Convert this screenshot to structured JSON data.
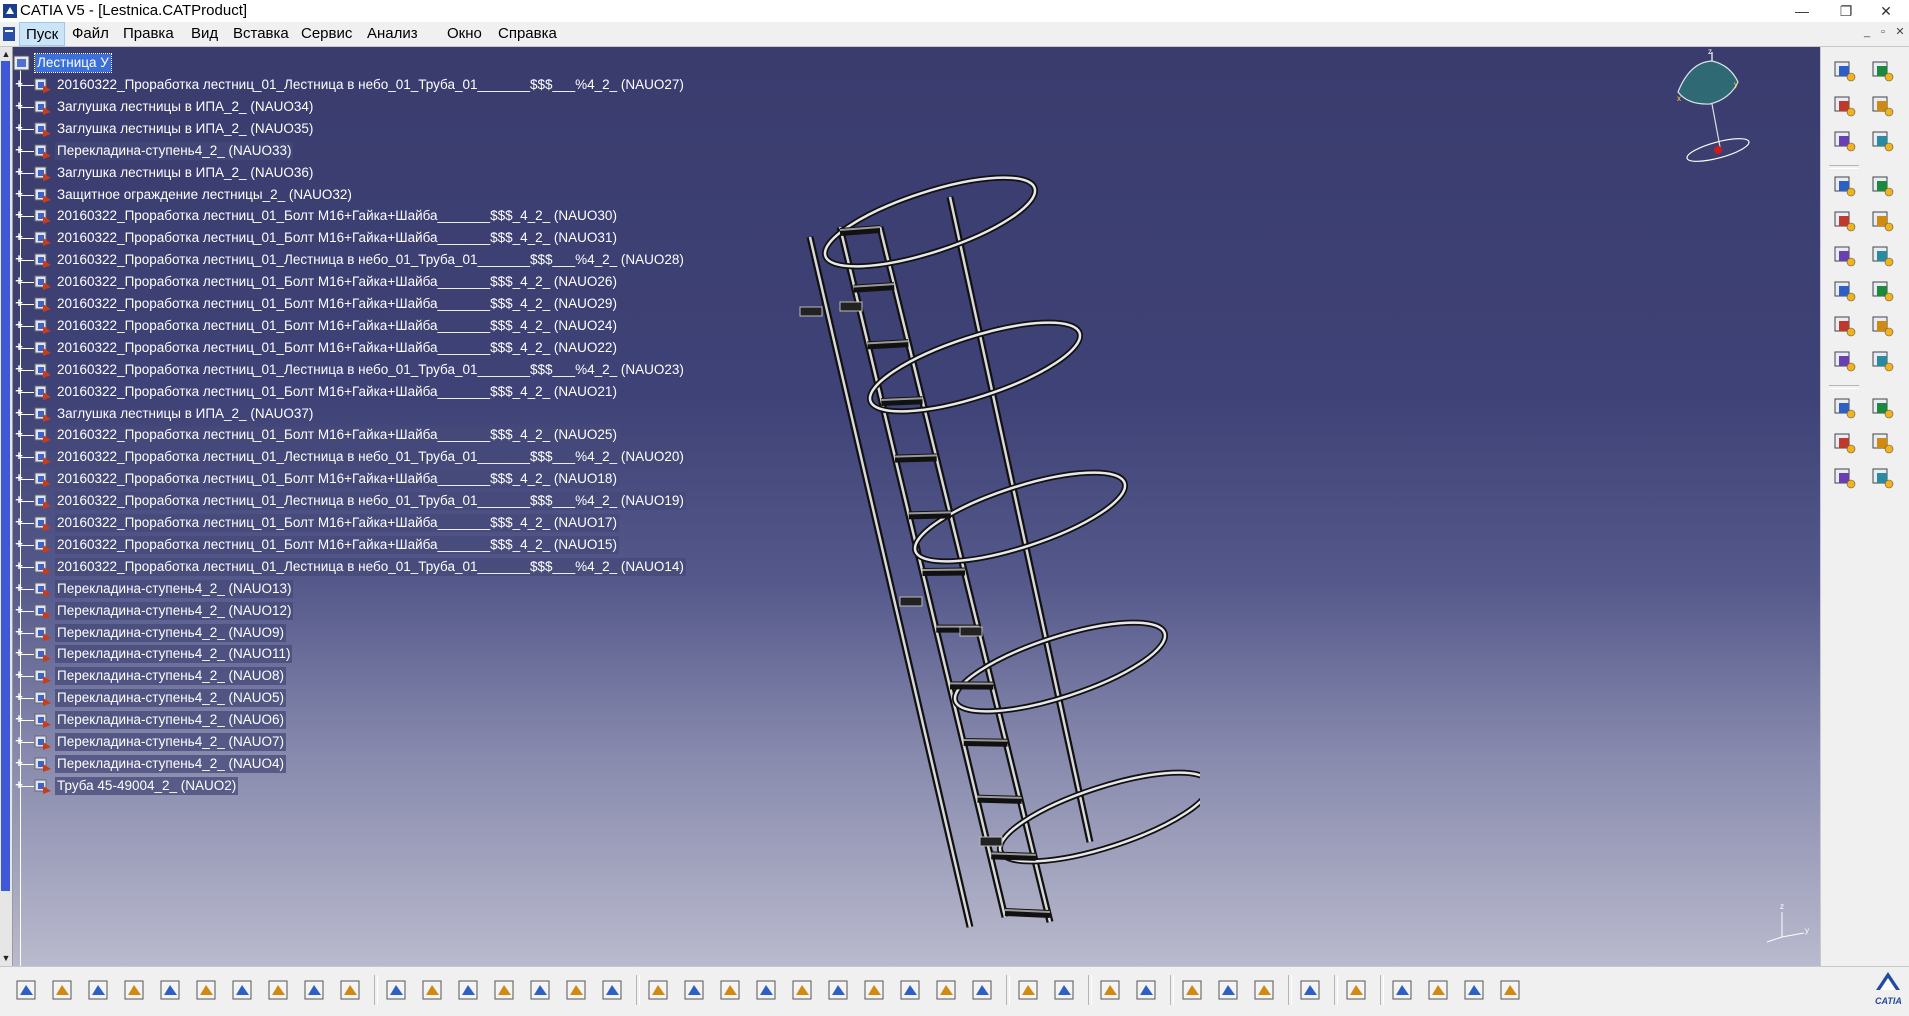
{
  "window": {
    "title": "CATIA V5 - [Lestnica.CATProduct]",
    "minimize": "—",
    "restore": "❐",
    "close": "✕"
  },
  "menu": {
    "items": [
      "Пуск",
      "Файл",
      "Правка",
      "Вид",
      "Вставка",
      "Сервис",
      "Анализ",
      "Окно",
      "Справка"
    ]
  },
  "tree": {
    "root": "Лестница У",
    "nodes": [
      "20160322_Проработка лестниц_01_Лестница в небо_01_Труба_01_______$$$___%4_2_ (NAUO27)",
      "Заглушка лестницы в ИПА_2_ (NAUO34)",
      "Заглушка лестницы в ИПА_2_ (NAUO35)",
      "Перекладина-ступень4_2_ (NAUO33)",
      "Заглушка лестницы в ИПА_2_ (NAUO36)",
      "Защитное ограждение  лестницы_2_ (NAUO32)",
      "20160322_Проработка лестниц_01_Болт М16+Гайка+Шайба_______$$$_4_2_ (NAUO30)",
      "20160322_Проработка лестниц_01_Болт М16+Гайка+Шайба_______$$$_4_2_ (NAUO31)",
      "20160322_Проработка лестниц_01_Лестница в небо_01_Труба_01_______$$$___%4_2_ (NAUO28)",
      "20160322_Проработка лестниц_01_Болт М16+Гайка+Шайба_______$$$_4_2_ (NAUO26)",
      "20160322_Проработка лестниц_01_Болт М16+Гайка+Шайба_______$$$_4_2_ (NAUO29)",
      "20160322_Проработка лестниц_01_Болт М16+Гайка+Шайба_______$$$_4_2_ (NAUO24)",
      "20160322_Проработка лестниц_01_Болт М16+Гайка+Шайба_______$$$_4_2_ (NAUO22)",
      "20160322_Проработка лестниц_01_Лестница в небо_01_Труба_01_______$$$___%4_2_ (NAUO23)",
      "20160322_Проработка лестниц_01_Болт М16+Гайка+Шайба_______$$$_4_2_ (NAUO21)",
      "Заглушка лестницы в ИПА_2_ (NAUO37)",
      "20160322_Проработка лестниц_01_Болт М16+Гайка+Шайба_______$$$_4_2_ (NAUO25)",
      "20160322_Проработка лестниц_01_Лестница в небо_01_Труба_01_______$$$___%4_2_ (NAUO20)",
      "20160322_Проработка лестниц_01_Болт М16+Гайка+Шайба_______$$$_4_2_ (NAUO18)",
      "20160322_Проработка лестниц_01_Лестница в небо_01_Труба_01_______$$$___%4_2_ (NAUO19)",
      "20160322_Проработка лестниц_01_Болт М16+Гайка+Шайба_______$$$_4_2_ (NAUO17)",
      "20160322_Проработка лестниц_01_Болт М16+Гайка+Шайба_______$$$_4_2_ (NAUO15)",
      "20160322_Проработка лестниц_01_Лестница в небо_01_Труба_01_______$$$___%4_2_ (NAUO14)",
      "Перекладина-ступень4_2_ (NAUO13)",
      "Перекладина-ступень4_2_ (NAUO12)",
      "Перекладина-ступень4_2_ (NAUO9)",
      "Перекладина-ступень4_2_ (NAUO11)",
      "Перекладина-ступень4_2_ (NAUO8)",
      "Перекладина-ступень4_2_ (NAUO5)",
      "Перекладина-ступень4_2_ (NAUO6)",
      "Перекладина-ступень4_2_ (NAUO7)",
      "Перекладина-ступень4_2_ (NAUO4)",
      "Труба 45-49004_2_ (NAUO2)"
    ]
  },
  "compass": {
    "x": "x",
    "y": "y",
    "z": "z"
  },
  "logo_text": "CATIA",
  "colors": {
    "selection": "#3b6fd9",
    "viewport_top": "#3a3c6e",
    "viewport_bottom": "#b9bacd"
  },
  "right_toolbar_icons": [
    "assembly-new-component-icon",
    "existing-component-icon",
    "replace-component-icon",
    "graph-tree-icon",
    "generate-numbering-icon",
    "reuse-pattern-icon",
    "fast-multi-instantiation-icon",
    "manipulation-icon",
    "snap-icon",
    "explode-icon",
    "clash-icon",
    "coincidence-constraint-icon",
    "contact-constraint-icon",
    "offset-constraint-icon",
    "angle-constraint-icon",
    "fix-component-icon",
    "fix-together-icon",
    "quick-constraint-icon",
    "flexible-rigid-icon",
    "change-constraint-icon",
    "reuse-constraint-icon",
    "update-icon",
    "scenes-icon",
    "annotation-icon"
  ],
  "bottom_toolbar_icons": [
    "new-icon",
    "open-icon",
    "save-icon",
    "print-icon",
    "cut-icon",
    "copy-icon",
    "paste-icon",
    "undo-icon",
    "redo-icon",
    "whats-this-icon",
    "formula-icon",
    "comment-icon",
    "tools-options-icon",
    "table-icon",
    "catalog-icon",
    "knowledge-icon",
    "parameters-icon",
    "fly-mode-icon",
    "fit-all-icon",
    "pan-icon",
    "rotate-icon",
    "zoom-in-icon",
    "zoom-out-icon",
    "normal-view-icon",
    "multi-view-icon",
    "isometric-view-icon",
    "shading-icon",
    "hide-show-icon",
    "swap-visible-space-icon",
    "measure-between-icon",
    "capture-icon",
    "catalog-browser-icon",
    "measure-item-icon",
    "measure-inertia-icon",
    "refresh-icon",
    "plane-icon",
    "render-style-icon",
    "material-icon",
    "apply-material-icon",
    "grid-icon"
  ]
}
